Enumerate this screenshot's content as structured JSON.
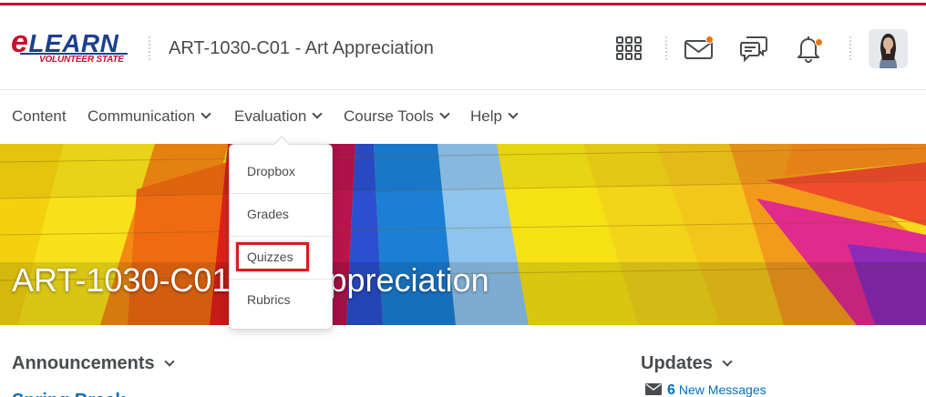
{
  "header": {
    "logo": {
      "brand_e": "e",
      "brand_rest": "LEARN",
      "subtitle": "VOLUNTEER STATE"
    },
    "course_title": "ART-1030-C01 - Art Appreciation",
    "icons": [
      "waffle-icon",
      "mail-icon",
      "chat-icon",
      "bell-icon",
      "avatar"
    ],
    "notification_color": "#e87511"
  },
  "nav": {
    "items": [
      {
        "label": "Content",
        "has_menu": false
      },
      {
        "label": "Communication",
        "has_menu": true
      },
      {
        "label": "Evaluation",
        "has_menu": true
      },
      {
        "label": "Course Tools",
        "has_menu": true
      },
      {
        "label": "Help",
        "has_menu": true
      }
    ]
  },
  "banner": {
    "title": "ART-1030-C01 - Art Appreciation"
  },
  "evaluation_menu": {
    "items": [
      {
        "label": "Dropbox"
      },
      {
        "label": "Grades"
      },
      {
        "label": "Quizzes",
        "highlighted": true
      },
      {
        "label": "Rubrics"
      }
    ],
    "highlight_color": "#d21f1f"
  },
  "widgets": {
    "announcements": {
      "title": "Announcements",
      "first_item": "Spring Break"
    },
    "updates": {
      "title": "Updates",
      "count": "6",
      "label": "New Messages"
    }
  },
  "colors": {
    "accent_red": "#c8102e",
    "link_blue": "#006fbf",
    "brand_blue": "#1d3f8f"
  }
}
